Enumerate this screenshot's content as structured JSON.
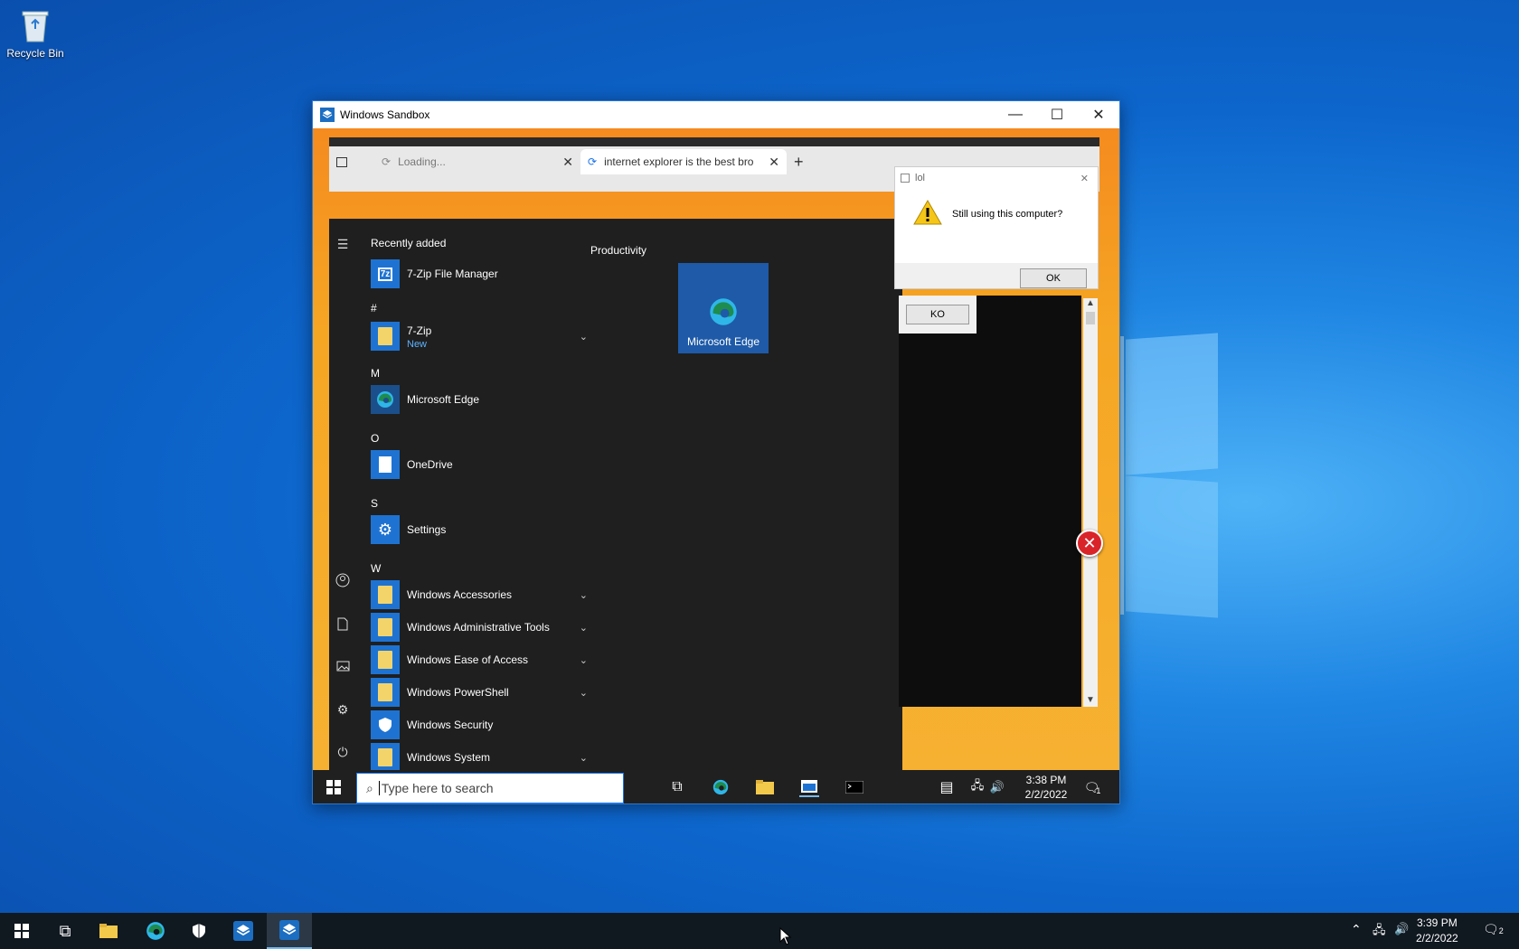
{
  "desktop": {
    "icons": [
      {
        "label": "Recycle Bin",
        "icon": "recycle-bin-icon"
      }
    ]
  },
  "sandbox": {
    "title": "Windows Sandbox",
    "controls": {
      "minimize": "—",
      "maximize": "☐",
      "close": "✕"
    }
  },
  "browser": {
    "tabs": [
      {
        "label": "Loading...",
        "close": "✕"
      },
      {
        "label": "internet explorer is the best bro",
        "close": "✕"
      }
    ],
    "new_tab": "+"
  },
  "start_menu": {
    "recently_added_title": "Recently added",
    "recently_added": [
      {
        "label": "7-Zip File Manager",
        "icon": "7zip-icon"
      }
    ],
    "sections": [
      {
        "letter": "#",
        "items": [
          {
            "label": "7-Zip",
            "sub": "New",
            "expandable": true
          }
        ]
      },
      {
        "letter": "M",
        "items": [
          {
            "label": "Microsoft Edge"
          }
        ]
      },
      {
        "letter": "O",
        "items": [
          {
            "label": "OneDrive"
          }
        ]
      },
      {
        "letter": "S",
        "items": [
          {
            "label": "Settings"
          }
        ]
      },
      {
        "letter": "W",
        "items": [
          {
            "label": "Windows Accessories",
            "expandable": true
          },
          {
            "label": "Windows Administrative Tools",
            "expandable": true
          },
          {
            "label": "Windows Ease of Access",
            "expandable": true
          },
          {
            "label": "Windows PowerShell",
            "expandable": true
          },
          {
            "label": "Windows Security"
          },
          {
            "label": "Windows System",
            "expandable": true
          }
        ]
      }
    ],
    "productivity_title": "Productivity",
    "tile": {
      "label": "Microsoft Edge"
    }
  },
  "inner_taskbar": {
    "search_placeholder": "Type here to search",
    "time": "3:38 PM",
    "date": "2/2/2022",
    "notifications": "1"
  },
  "dialog": {
    "title": "lol",
    "message": "Still using this computer?",
    "ok": "OK",
    "ko": "KO"
  },
  "taskbar": {
    "time": "3:39 PM",
    "date": "2/2/2022",
    "notifications": "2"
  }
}
